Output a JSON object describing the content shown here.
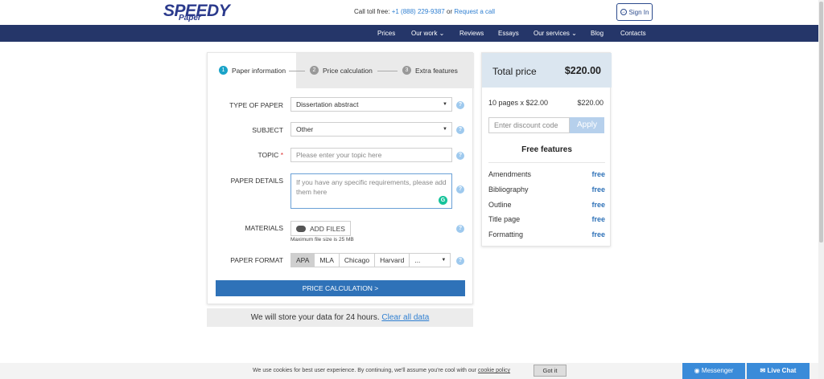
{
  "header": {
    "logo_big": "SPEEDY",
    "logo_small": "Paper",
    "toll_free_label": "Call toll free:",
    "phone": "+1 (888) 229-9387",
    "or": "or",
    "request_call": "Request a call",
    "sign_in": "Sign In"
  },
  "nav": {
    "items": [
      "Prices",
      "Our work ⌄",
      "Reviews",
      "Essays",
      "Our services ⌄",
      "Blog",
      "Contacts"
    ]
  },
  "steps": [
    {
      "num": "1",
      "label": "Paper information"
    },
    {
      "num": "2",
      "label": "Price calculation"
    },
    {
      "num": "3",
      "label": "Extra features"
    }
  ],
  "form": {
    "type_label": "TYPE OF PAPER",
    "type_value": "Dissertation abstract",
    "subject_label": "SUBJECT",
    "subject_value": "Other",
    "topic_label": "TOPIC",
    "topic_required": "*",
    "topic_placeholder": "Please enter your topic here",
    "details_label": "PAPER DETAILS",
    "details_placeholder": "If you have any specific requirements, please add them here",
    "materials_label": "MATERIALS",
    "add_files": "ADD FILES",
    "max_size": "Maximum file size is 25 MB",
    "format_label": "PAPER FORMAT",
    "formats": [
      "APA",
      "MLA",
      "Chicago",
      "Harvard",
      "..."
    ],
    "help": "?",
    "submit": "PRICE CALCULATION >"
  },
  "store": {
    "text": "We will store your data for 24 hours.",
    "clear": "Clear all data"
  },
  "price": {
    "total_label": "Total price",
    "total_value": "$220.00",
    "calc_text": "10 pages x $22.00",
    "calc_value": "$220.00",
    "discount_placeholder": "Enter discount code",
    "apply": "Apply",
    "features_title": "Free features",
    "features": [
      {
        "name": "Amendments",
        "price": "free"
      },
      {
        "name": "Bibliography",
        "price": "free"
      },
      {
        "name": "Outline",
        "price": "free"
      },
      {
        "name": "Title page",
        "price": "free"
      },
      {
        "name": "Formatting",
        "price": "free"
      }
    ]
  },
  "cookie": {
    "text": "We use cookies for best user experience. By continuing, we'll assume you're cool with our",
    "policy": "cookie policy",
    "button": "Got it"
  },
  "chat": {
    "messenger": "Messenger",
    "live_chat": "Live Chat"
  }
}
